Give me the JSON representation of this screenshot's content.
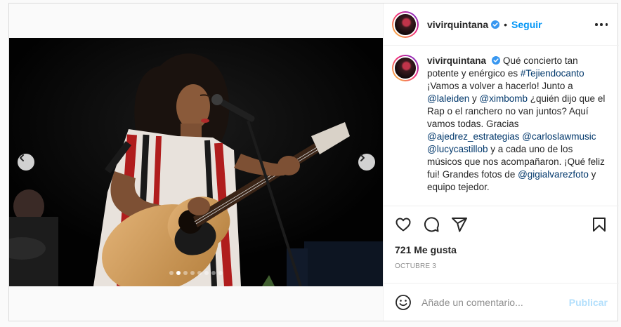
{
  "post": {
    "username": "vivirquintana",
    "follow_label": "Seguir",
    "separator": "•",
    "caption": {
      "segments": [
        {
          "t": "Qué concierto tan potente y enérgico es "
        },
        {
          "t": "#Tejiendocanto",
          "link": true
        },
        {
          "t": " ¡Vamos a volver a hacerlo! Junto a "
        },
        {
          "t": "@laleiden",
          "link": true
        },
        {
          "t": " y "
        },
        {
          "t": "@ximbomb",
          "link": true
        },
        {
          "t": " ¿quién dijo que el Rap o el ranchero no van juntos? Aquí vamos todas. Gracias "
        },
        {
          "t": "@ajedrez_estrategias",
          "link": true
        },
        {
          "t": " "
        },
        {
          "t": "@carloslawmusic",
          "link": true
        },
        {
          "t": " "
        },
        {
          "t": "@lucycastillob",
          "link": true
        },
        {
          "t": " y a cada uno de los músicos que nos acompañaron. ¡Qué feliz fui! Grandes fotos de "
        },
        {
          "t": "@gigialvarezfoto",
          "link": true
        },
        {
          "t": " y equipo tejedor."
        }
      ]
    },
    "likes": "721 Me gusta",
    "date": "Octubre 3",
    "carousel": {
      "total": 8,
      "active": 1
    },
    "comment": {
      "placeholder": "Añade un comentario...",
      "value": "",
      "publish_label": "Publicar"
    }
  },
  "icons": {
    "verified": "verified-badge-icon",
    "more": "more-options-icon",
    "like": "heart-icon",
    "comment": "comment-bubble-icon",
    "share": "paper-plane-icon",
    "save": "bookmark-icon",
    "emoji": "emoji-smile-icon",
    "prev": "chevron-left-icon",
    "next": "chevron-right-icon"
  },
  "colors": {
    "accent": "#0095f6",
    "verified": "#3897f0",
    "link": "#00376b",
    "publish_disabled": "#b2dffc",
    "muted": "#8e8e8e"
  }
}
